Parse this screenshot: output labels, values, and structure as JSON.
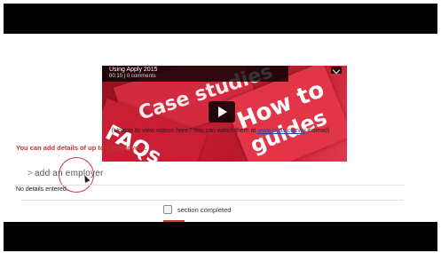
{
  "video": {
    "title": "Using Apply 2015",
    "meta": "00:10 | 0 comments",
    "thumbnail_words": {
      "studies": "Case studies",
      "howto": "How to",
      "guides": "guides",
      "faqs": "FAQs"
    }
  },
  "fallback": {
    "prefix": "(Unable to view videos here? You can watch them at ",
    "link": "www.ucas.com/tv",
    "suffix": " instead)"
  },
  "employers": {
    "note": "You can add details of up to 5 employers.",
    "add_label": "add an employer",
    "no_details": "No details entered."
  },
  "section": {
    "completed_label": "section completed"
  },
  "colors": {
    "accent": "#c0392b",
    "video_red": "#c21a2c",
    "link": "#1a4a9e"
  }
}
